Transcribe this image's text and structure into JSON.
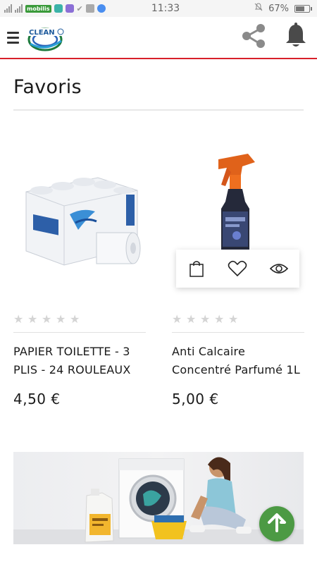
{
  "status_bar": {
    "carrier_badge": "mobilis",
    "time": "11:33",
    "battery": "67%",
    "battery_level": 0.67
  },
  "header": {
    "logo_text": "CLEAN",
    "icons": [
      "hamburger-menu-icon",
      "share-icon",
      "bell-icon"
    ]
  },
  "page": {
    "title": "Favoris"
  },
  "products": [
    {
      "name": "PAPIER TOILETTE - 3 PLIS - 24 ROULEAUX",
      "price": "4,50 €",
      "rating": 0,
      "max_rating": 5
    },
    {
      "name": "Anti Calcaire Concentré Parfumé 1L",
      "price": "5,00 €",
      "rating": 0,
      "max_rating": 5,
      "actions": [
        "shopping-bag-icon",
        "heart-icon",
        "eye-icon"
      ]
    }
  ],
  "colors": {
    "header_border": "#d8202a",
    "scroll_button": "#4c9a44",
    "star_empty": "#d4d4d4"
  }
}
